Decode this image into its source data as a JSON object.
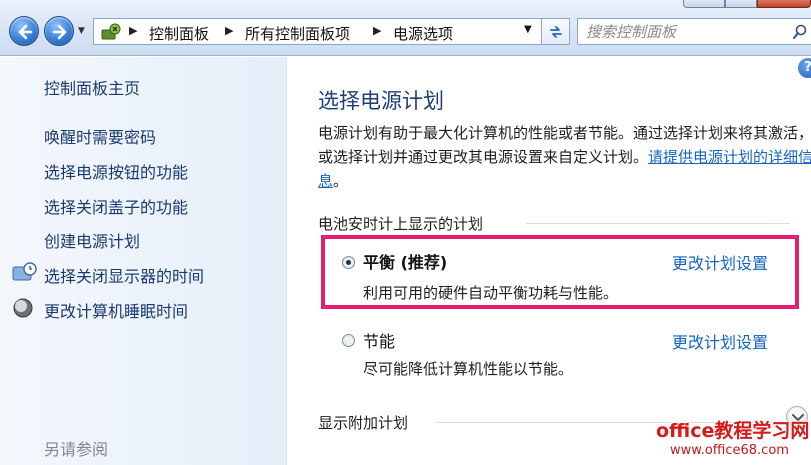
{
  "address_bar": {
    "breadcrumbs": [
      "控制面板",
      "所有控制面板项",
      "电源选项"
    ],
    "search_placeholder": "搜索控制面板"
  },
  "sidebar": {
    "home": "控制面板主页",
    "links": [
      "唤醒时需要密码",
      "选择电源按钮的功能",
      "选择关闭盖子的功能",
      "创建电源计划",
      "选择关闭显示器的时间",
      "更改计算机睡眠时间"
    ],
    "see_also": "另请参阅"
  },
  "main": {
    "title": "选择电源计划",
    "description": "电源计划有助于最大化计算机的性能或者节能。通过选择计划来将其激活，或选择计划并通过更改其电源设置来自定义计划。",
    "description_link_prefix": "请",
    "description_link": "提供电源计划的详细信息",
    "description_suffix": "。",
    "battery_group": "电池安时计上显示的计划",
    "plans": [
      {
        "name": "平衡 (推荐)",
        "desc": "利用可用的硬件自动平衡功耗与性能。",
        "selected": true,
        "link": "更改计划设置"
      },
      {
        "name": "节能",
        "desc": "尽可能降低计算机性能以节能。",
        "selected": false,
        "link": "更改计划设置"
      }
    ],
    "additional_group": "显示附加计划"
  },
  "watermark": {
    "title": "office教程学习网",
    "url": "www.office68.com"
  },
  "colors": {
    "highlight_border": "#e2206a",
    "link": "#1565c0",
    "title": "#1f3e74"
  }
}
